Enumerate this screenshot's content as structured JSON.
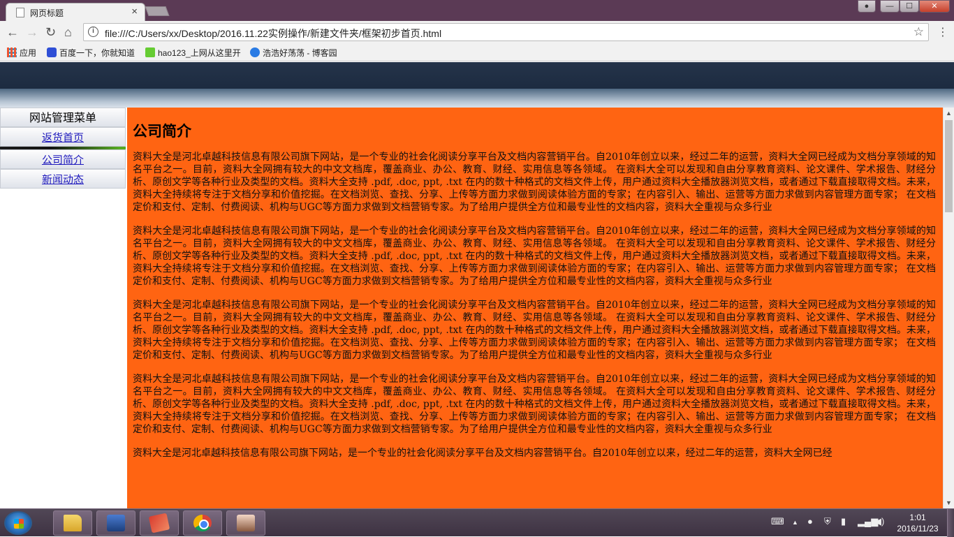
{
  "browser": {
    "tab_title": "网页标题",
    "tab_close": "×",
    "url": "file:///C:/Users/xx/Desktop/2016.11.22实例操作/新建文件夹/框架初步首页.html",
    "window_buttons": {
      "minimize": "—",
      "maximize": "☐",
      "close": "✕",
      "user": "●"
    },
    "nav": {
      "back": "←",
      "forward": "→",
      "reload": "↻",
      "home": "⌂",
      "star": "☆",
      "menu": "⋮",
      "info": "i"
    },
    "bookmarks": [
      {
        "label": "应用",
        "icon": "apps-grid-icon"
      },
      {
        "label": "百度一下，你就知道",
        "icon": "baidu-icon"
      },
      {
        "label": "hao123_上网从这里开",
        "icon": "hao123-icon"
      },
      {
        "label": "浩浩好荡荡 - 博客园",
        "icon": "cnblogs-icon"
      }
    ]
  },
  "page": {
    "sidebar": {
      "title": "网站管理菜单",
      "items": [
        "返货首页",
        "公司简介",
        "新闻动态"
      ]
    },
    "content": {
      "heading": "公司简介",
      "paragraphs": [
        "资料大全是河北卓越科技信息有限公司旗下网站，是一个专业的社会化阅读分享平台及文档内容营销平台。自2010年创立以来，经过二年的运营，资料大全网已经成为文档分享领域的知名平台之一。目前，资料大全网拥有较大的中文文档库，覆盖商业、办公、教育、财经、实用信息等各领域。 在资料大全可以发现和自由分享教育资料、论文课件、学术报告、财经分析、原创文学等各种行业及类型的文档。资料大全支持 .pdf, .doc, ppt, .txt 在内的数十种格式的文档文件上传，用户通过资料大全播放器浏览文档，或者通过下载直接取得文档。未来，资料大全持续将专注于文档分享和价值挖掘。在文档浏览、查找、分享、上传等方面力求做到阅读体验方面的专家；在内容引入、输出、运营等方面力求做到内容管理方面专家； 在文档定价和支付、定制、付费阅读、机构与UGC等方面力求做到文档营销专家。为了给用户提供全方位和最专业性的文档内容，资料大全重视与众多行业",
        "资料大全是河北卓越科技信息有限公司旗下网站，是一个专业的社会化阅读分享平台及文档内容营销平台。自2010年创立以来，经过二年的运营，资料大全网已经成为文档分享领域的知名平台之一。目前，资料大全网拥有较大的中文文档库，覆盖商业、办公、教育、财经、实用信息等各领域。 在资料大全可以发现和自由分享教育资料、论文课件、学术报告、财经分析、原创文学等各种行业及类型的文档。资料大全支持 .pdf, .doc, ppt, .txt 在内的数十种格式的文档文件上传，用户通过资料大全播放器浏览文档，或者通过下载直接取得文档。未来，资料大全持续将专注于文档分享和价值挖掘。在文档浏览、查找、分享、上传等方面力求做到阅读体验方面的专家；在内容引入、输出、运营等方面力求做到内容管理方面专家； 在文档定价和支付、定制、付费阅读、机构与UGC等方面力求做到文档营销专家。为了给用户提供全方位和最专业性的文档内容，资料大全重视与众多行业",
        "资料大全是河北卓越科技信息有限公司旗下网站，是一个专业的社会化阅读分享平台及文档内容营销平台。自2010年创立以来，经过二年的运营，资料大全网已经成为文档分享领域的知名平台之一。目前，资料大全网拥有较大的中文文档库，覆盖商业、办公、教育、财经、实用信息等各领域。 在资料大全可以发现和自由分享教育资料、论文课件、学术报告、财经分析、原创文学等各种行业及类型的文档。资料大全支持 .pdf, .doc, ppt, .txt 在内的数十种格式的文档文件上传，用户通过资料大全播放器浏览文档，或者通过下载直接取得文档。未来，资料大全持续将专注于文档分享和价值挖掘。在文档浏览、查找、分享、上传等方面力求做到阅读体验方面的专家；在内容引入、输出、运营等方面力求做到内容管理方面专家； 在文档定价和支付、定制、付费阅读、机构与UGC等方面力求做到文档营销专家。为了给用户提供全方位和最专业性的文档内容，资料大全重视与众多行业",
        "资料大全是河北卓越科技信息有限公司旗下网站，是一个专业的社会化阅读分享平台及文档内容营销平台。自2010年创立以来，经过二年的运营，资料大全网已经成为文档分享领域的知名平台之一。目前，资料大全网拥有较大的中文文档库，覆盖商业、办公、教育、财经、实用信息等各领域。 在资料大全可以发现和自由分享教育资料、论文课件、学术报告、财经分析、原创文学等各种行业及类型的文档。资料大全支持 .pdf, .doc, ppt, .txt 在内的数十种格式的文档文件上传，用户通过资料大全播放器浏览文档，或者通过下载直接取得文档。未来，资料大全持续将专注于文档分享和价值挖掘。在文档浏览、查找、分享、上传等方面力求做到阅读体验方面的专家；在内容引入、输出、运营等方面力求做到内容管理方面专家； 在文档定价和支付、定制、付费阅读、机构与UGC等方面力求做到文档营销专家。为了给用户提供全方位和最专业性的文档内容，资料大全重视与众多行业",
        "资料大全是河北卓越科技信息有限公司旗下网站，是一个专业的社会化阅读分享平台及文档内容营销平台。自2010年创立以来，经过二年的运营，资料大全网已经"
      ]
    },
    "colors": {
      "content_bg": "#ff6412",
      "header_dark": "#1f2e43",
      "link": "#1f1abd"
    }
  },
  "taskbar": {
    "apps": [
      "windows-explorer",
      "calculator",
      "paint",
      "google-chrome",
      "photo"
    ],
    "clock": {
      "time": "1:01",
      "date": "2016/11/23"
    },
    "tray_icons": [
      "keyboard-icon",
      "show-hidden-icon",
      "qq-icon",
      "shield-icon",
      "battery-icon",
      "network-icon",
      "volume-icon"
    ]
  }
}
